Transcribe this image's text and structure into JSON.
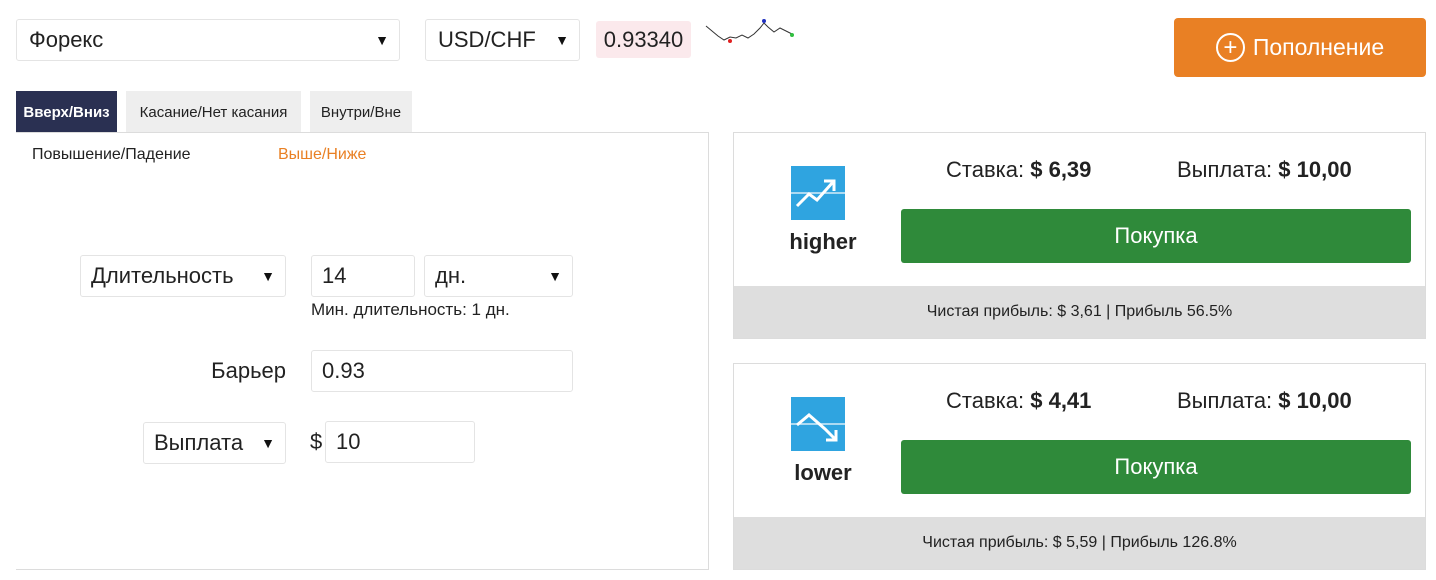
{
  "header": {
    "market": "Форекс",
    "asset": "USD/CHF",
    "spot": "0.93340",
    "deposit_label": "Пополнение"
  },
  "tabs": [
    {
      "label": "Вверх/Вниз",
      "active": true
    },
    {
      "label": "Касание/Нет касания",
      "active": false
    },
    {
      "label": "Внутри/Вне",
      "active": false
    }
  ],
  "subtabs": [
    {
      "label": "Повышение/Падение",
      "active": false
    },
    {
      "label": "Выше/Ниже",
      "active": true
    }
  ],
  "form": {
    "duration_type": "Длительность",
    "duration_value": "14",
    "duration_unit": "дн.",
    "min_duration_hint": "Мин. длительность: 1 дн.",
    "barrier_label": "Барьер",
    "barrier_value": "0.93",
    "payout_type": "Выплата",
    "currency_symbol": "$",
    "amount_value": "10"
  },
  "contracts": {
    "higher": {
      "name": "higher",
      "stake_label": "Ставка:",
      "stake_value": "$ 6,39",
      "payout_label": "Выплата:",
      "payout_value": "$ 10,00",
      "buy_label": "Покупка",
      "footer": "Чистая прибыль: $ 3,61 | Прибыль 56.5%"
    },
    "lower": {
      "name": "lower",
      "stake_label": "Ставка:",
      "stake_value": "$ 4,41",
      "payout_label": "Выплата:",
      "payout_value": "$ 10,00",
      "buy_label": "Покупка",
      "footer": "Чистая прибыль: $ 5,59 | Прибыль 126.8%"
    }
  },
  "colors": {
    "accent": "#e98024",
    "tab_active": "#2a3052",
    "buy": "#2f8a3a",
    "icon_bg": "#2fa4e0",
    "spot_bg": "#fbe9ec"
  },
  "icons": {
    "dropdown": "triangle-down-icon",
    "deposit": "plus-circle-icon",
    "higher": "trend-up-icon",
    "lower": "trend-down-icon",
    "sparkline": "sparkline-icon"
  }
}
